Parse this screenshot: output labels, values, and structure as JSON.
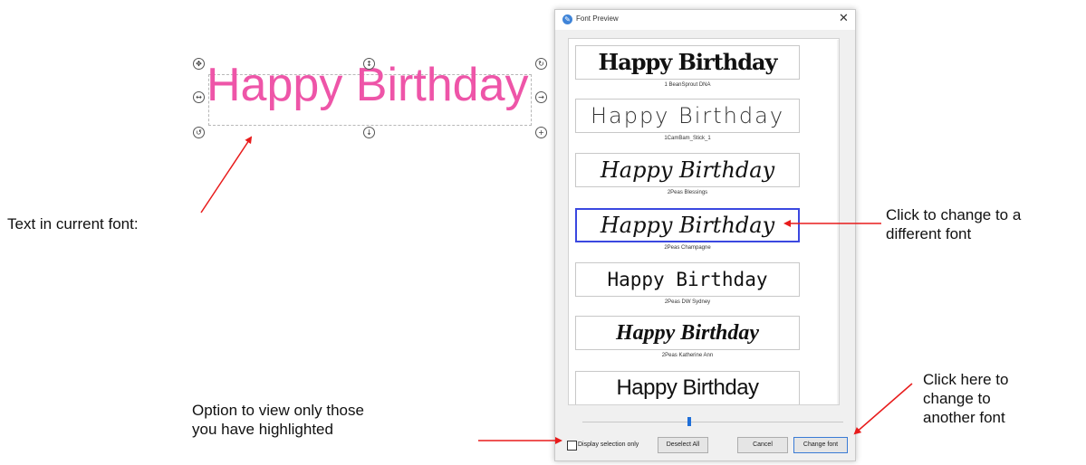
{
  "canvas": {
    "sample_text": "Happy Birthday",
    "text_color": "#ee55a8"
  },
  "annotations": {
    "current_font": "Text in current font:",
    "click_change_line1": "Click to change to a",
    "click_change_line2": "different font",
    "click_here_line1": "Click here to",
    "click_here_line2": "change to",
    "click_here_line3": "another font",
    "option_line1": "Option to view only those",
    "option_line2": "you have highlighted",
    "arrow_color": "#e81b1b"
  },
  "dialog": {
    "title": "Font Preview",
    "close_glyph": "✕",
    "fonts": [
      {
        "preview": "Happy Birthday",
        "name": "1 BeanSprout DNA",
        "selected": false
      },
      {
        "preview": "Happy Birthday",
        "name": "1CamBam_Stick_1",
        "selected": false
      },
      {
        "preview": "Happy Birthday",
        "name": "2Peas Blessings",
        "selected": false
      },
      {
        "preview": "Happy Birthday",
        "name": "2Peas Champagne",
        "selected": true
      },
      {
        "preview": "Happy Birthday",
        "name": "2Peas DW Sydney",
        "selected": false
      },
      {
        "preview": "Happy Birthday",
        "name": "2Peas Katherine Ann",
        "selected": false
      },
      {
        "preview": "Happy Birthday",
        "name": "",
        "selected": false
      }
    ],
    "display_selection_only_label": "Display selection only",
    "display_selection_only_checked": false,
    "buttons": {
      "deselect_all": "Deselect All",
      "cancel": "Cancel",
      "change_font": "Change font"
    },
    "highlight_color": "#3b48e0"
  }
}
